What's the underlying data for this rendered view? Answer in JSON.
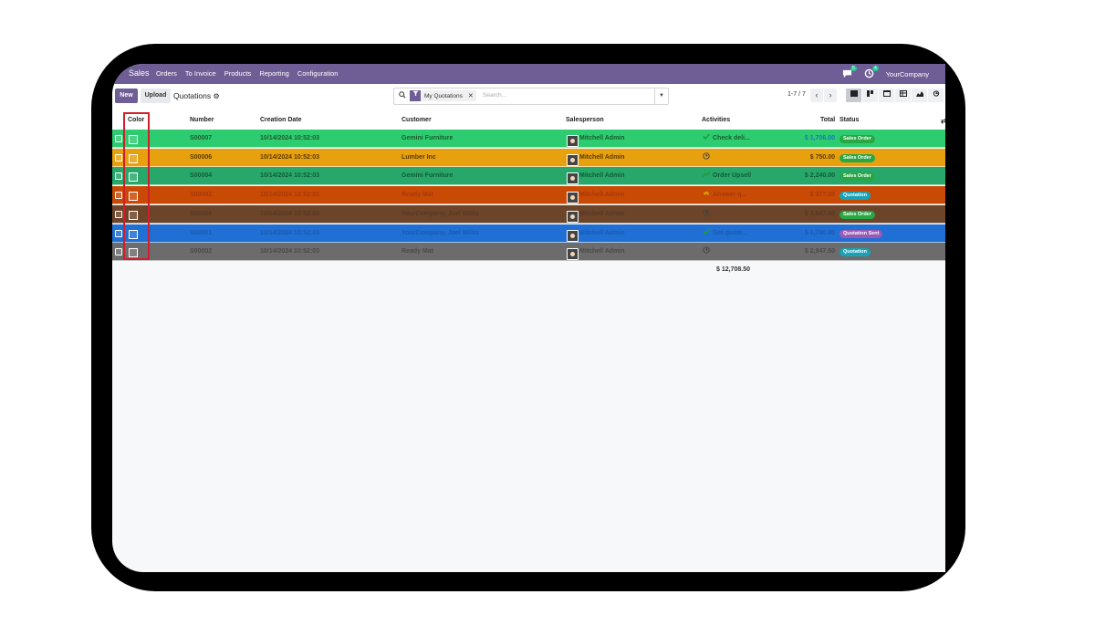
{
  "navbar": {
    "app_name": "Sales",
    "menu": [
      "Orders",
      "To Invoice",
      "Products",
      "Reporting",
      "Configuration"
    ],
    "messages_count": "5",
    "activities_count": "4",
    "company": "YourCompany"
  },
  "control": {
    "new_label": "New",
    "upload_label": "Upload",
    "breadcrumb": "Quotations",
    "filter_facet": "My Quotations",
    "search_placeholder": "Search...",
    "pager": "1-7 / 7"
  },
  "columns": {
    "color": "Color",
    "number": "Number",
    "creation_date": "Creation Date",
    "customer": "Customer",
    "salesperson": "Salesperson",
    "activities": "Activities",
    "total": "Total",
    "status": "Status"
  },
  "rows": [
    {
      "number": "S00007",
      "date": "10/14/2024 10:52:03",
      "customer": "Gemini Furniture",
      "salesperson": "Mitchell Admin",
      "activity": "Check deli...",
      "activity_icon": "check-icon",
      "total": "$ 1,706.00",
      "status": "Sales Order",
      "bg": "#2ecc71",
      "fg": "#1a5c2b",
      "status_color": "#28a745",
      "total_color": "#1a73c8"
    },
    {
      "number": "S00006",
      "date": "10/14/2024 10:52:03",
      "customer": "Lumber Inc",
      "salesperson": "Mitchell Admin",
      "activity": "",
      "activity_icon": "clock-icon",
      "total": "$ 750.00",
      "status": "Sales Order",
      "bg": "#e8a10e",
      "fg": "#5a3a00",
      "status_color": "#28a745",
      "total_color": "#5a3a00"
    },
    {
      "number": "S00004",
      "date": "10/14/2024 10:52:03",
      "customer": "Gemini Furniture",
      "salesperson": "Mitchell Admin",
      "activity": "Order Upsell",
      "activity_icon": "chart-icon",
      "total": "$ 2,240.00",
      "status": "Sales Order",
      "bg": "#27a86a",
      "fg": "#145a36",
      "status_color": "#28a745",
      "total_color": "#145a36"
    },
    {
      "number": "S00003",
      "date": "10/14/2024 10:52:03",
      "customer": "Ready Mat",
      "salesperson": "Mitchell Admin",
      "activity": "Answer q...",
      "activity_icon": "phone-icon",
      "total": "$ 377.50",
      "status": "Quotation",
      "bg": "#c94a05",
      "fg": "#a6390a",
      "status_color": "#17a2b8",
      "total_color": "#a6390a"
    },
    {
      "number": "S00008",
      "date": "10/14/2024 10:52:03",
      "customer": "YourCompany, Joel Willis",
      "salesperson": "Mitchell Admin",
      "activity": "",
      "activity_icon": "clock-icon",
      "total": "$ 2,947.50",
      "status": "Sales Order",
      "bg": "#6b4429",
      "fg": "#5a3822",
      "status_color": "#28a745",
      "total_color": "#5a3822"
    },
    {
      "number": "S00001",
      "date": "10/14/2024 10:52:03",
      "customer": "YourCompany, Joel Willis",
      "salesperson": "Mitchell Admin",
      "activity": "Get quote...",
      "activity_icon": "check-icon",
      "total": "$ 1,740.00",
      "status": "Quotation Sent",
      "bg": "#1f6fd4",
      "fg": "#1a5bb0",
      "status_color": "#9b59b6",
      "total_color": "#1a5bb0"
    },
    {
      "number": "S00002",
      "date": "10/14/2024 10:52:03",
      "customer": "Ready Mat",
      "salesperson": "Mitchell Admin",
      "activity": "",
      "activity_icon": "clock-icon",
      "total": "$ 2,947.50",
      "status": "Quotation",
      "bg": "#6c6c6c",
      "fg": "#4a4a4a",
      "status_color": "#17a2b8",
      "total_color": "#4a4a4a"
    }
  ],
  "sum_total": "$ 12,708.50"
}
